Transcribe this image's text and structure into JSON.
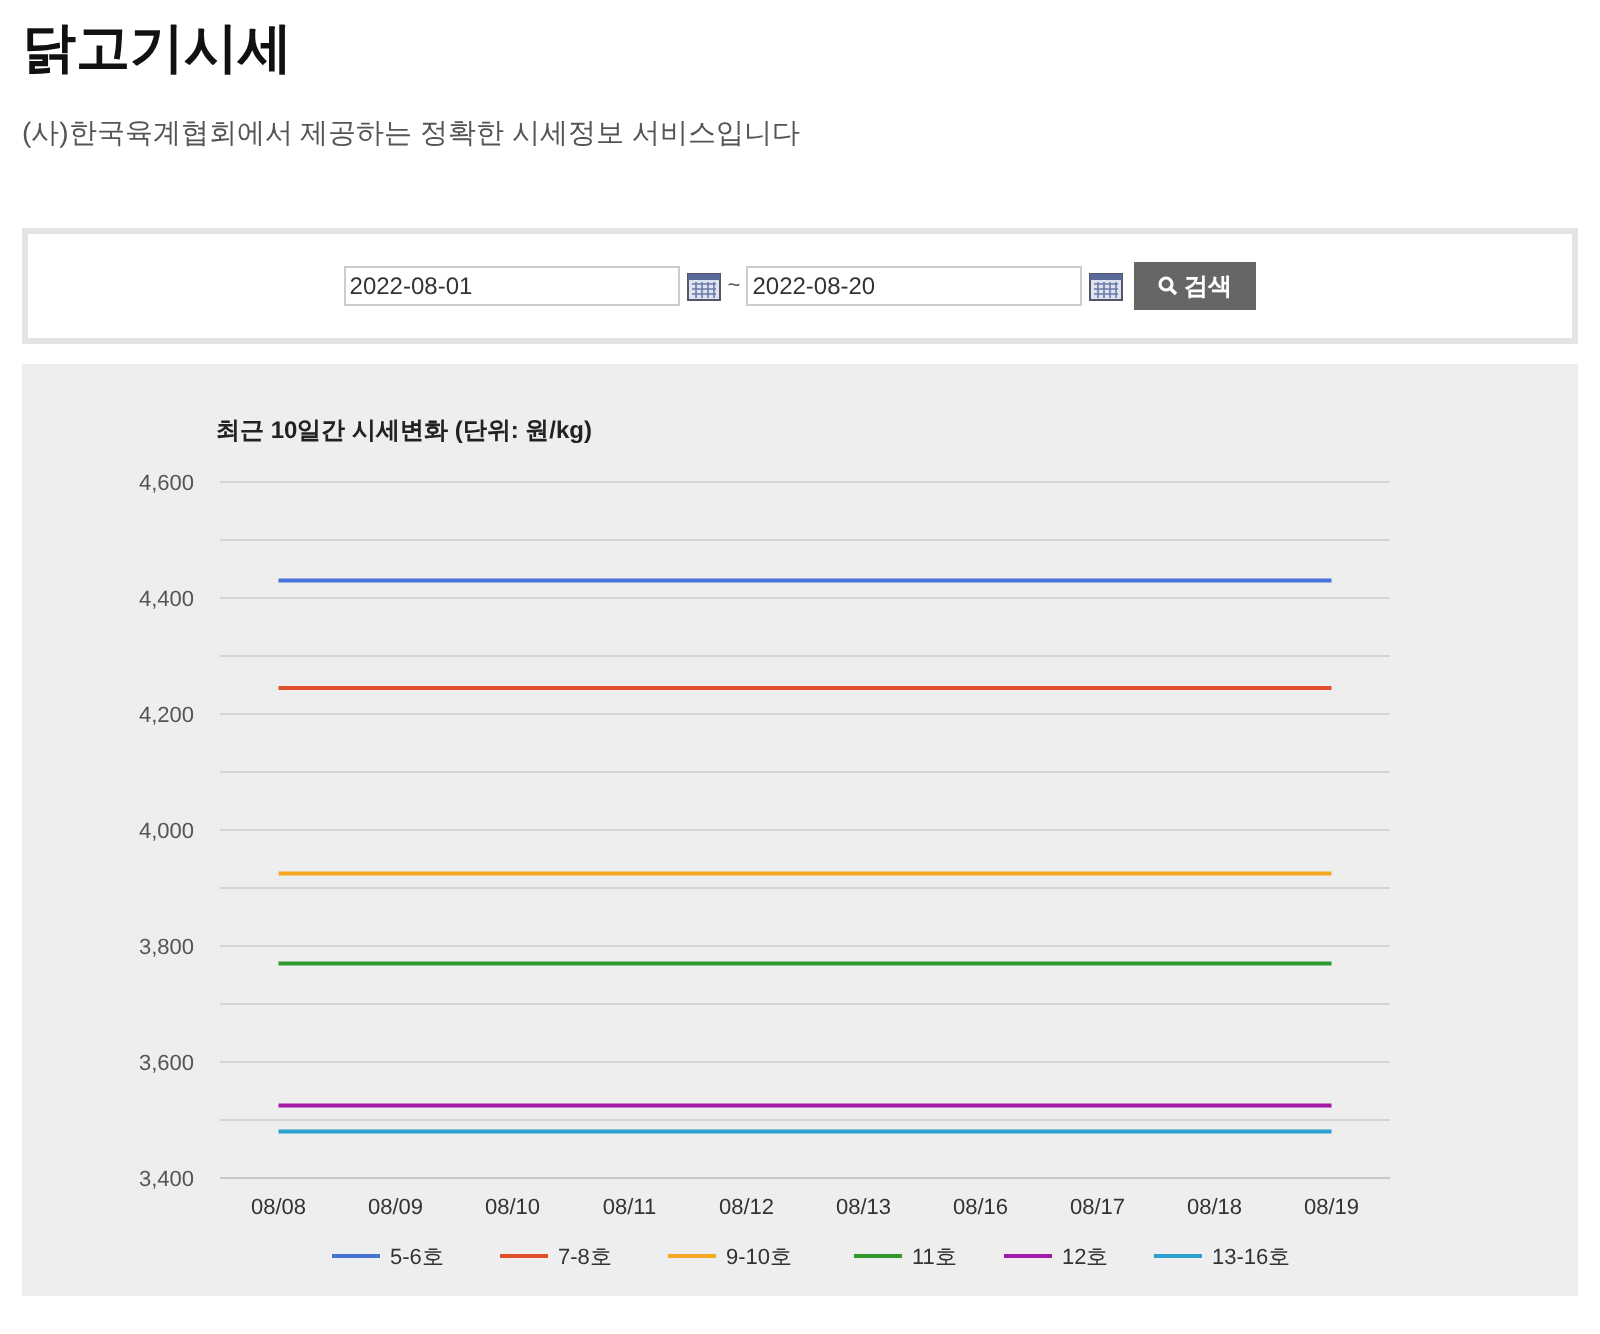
{
  "title": "닭고기시세",
  "subtitle": "(사)한국육계협회에서 제공하는 정확한 시세정보 서비스입니다",
  "search": {
    "start_date": "2022-08-01",
    "separator": "~",
    "end_date": "2022-08-20",
    "button": "검색"
  },
  "chart_data": {
    "type": "line",
    "title": "최근 10일간 시세변화 (단위: 원/kg)",
    "categories": [
      "08/08",
      "08/09",
      "08/10",
      "08/11",
      "08/12",
      "08/13",
      "08/16",
      "08/17",
      "08/18",
      "08/19"
    ],
    "ylim": [
      3400,
      4600
    ],
    "grid": true,
    "legend": true,
    "yticks": [
      {
        "value": 3400,
        "label": "3,400"
      },
      {
        "value": 3600,
        "label": "3,600"
      },
      {
        "value": 3800,
        "label": "3,800"
      },
      {
        "value": 4000,
        "label": "4,000"
      },
      {
        "value": 4200,
        "label": "4,200"
      },
      {
        "value": 4400,
        "label": "4,400"
      },
      {
        "value": 4600,
        "label": "4,600"
      }
    ],
    "series": [
      {
        "name": "5-6호",
        "color": "#4472d6",
        "values": [
          4430,
          4430,
          4430,
          4430,
          4430,
          4430,
          4430,
          4430,
          4430,
          4430
        ]
      },
      {
        "name": "7-8호",
        "color": "#e0502a",
        "values": [
          4245,
          4245,
          4245,
          4245,
          4245,
          4245,
          4245,
          4245,
          4245,
          4245
        ]
      },
      {
        "name": "9-10호",
        "color": "#f7a823",
        "values": [
          3925,
          3925,
          3925,
          3925,
          3925,
          3925,
          3925,
          3925,
          3925,
          3925
        ]
      },
      {
        "name": "11호",
        "color": "#2e9a2e",
        "values": [
          3770,
          3770,
          3770,
          3770,
          3770,
          3770,
          3770,
          3770,
          3770,
          3770
        ]
      },
      {
        "name": "12호",
        "color": "#a21aa6",
        "values": [
          3525,
          3525,
          3525,
          3525,
          3525,
          3525,
          3525,
          3525,
          3525,
          3525
        ]
      },
      {
        "name": "13-16호",
        "color": "#2aa0d0",
        "values": [
          3480,
          3480,
          3480,
          3480,
          3480,
          3480,
          3480,
          3480,
          3480,
          3480
        ]
      }
    ]
  }
}
